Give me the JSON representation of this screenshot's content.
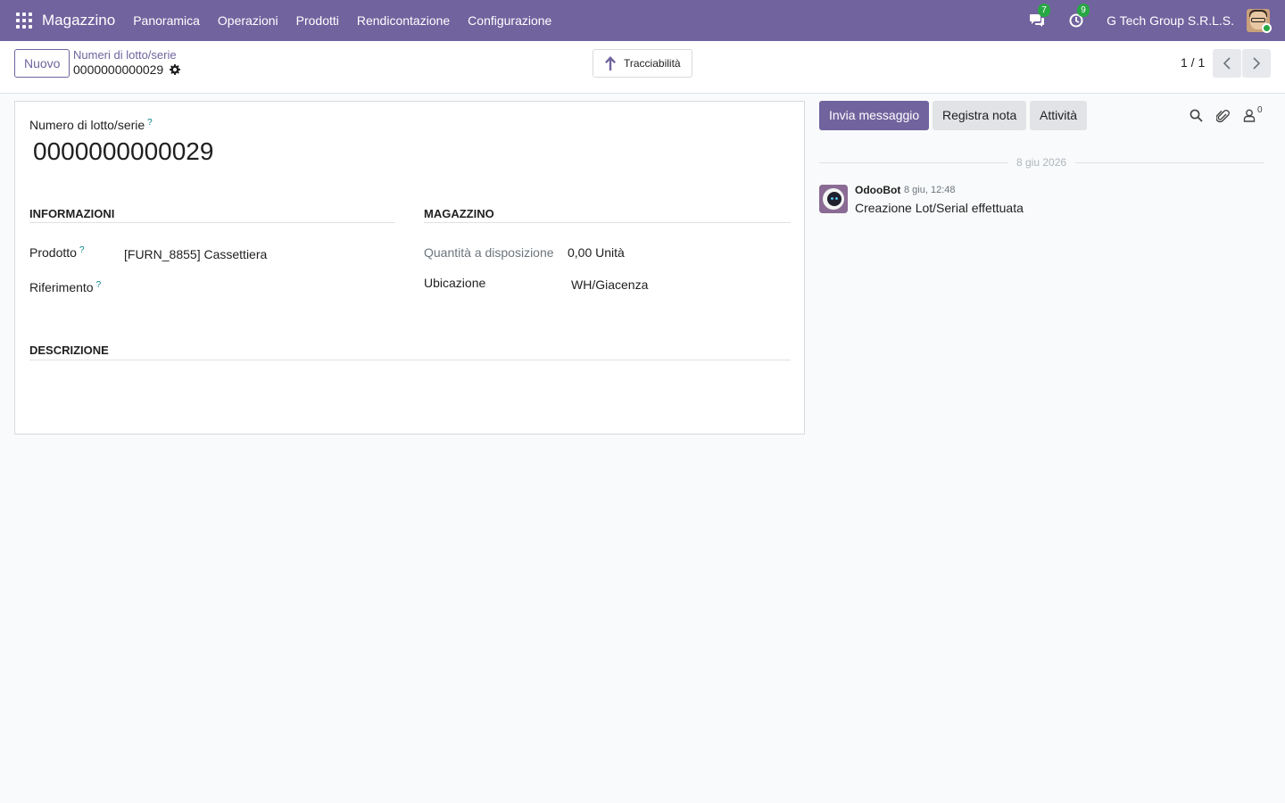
{
  "navbar": {
    "app_name": "Magazzino",
    "menu": [
      "Panoramica",
      "Operazioni",
      "Prodotti",
      "Rendicontazione",
      "Configurazione"
    ],
    "messages_count": "7",
    "activities_count": "9",
    "company": "G Tech Group S.R.L.S."
  },
  "control_panel": {
    "new_button": "Nuovo",
    "breadcrumb_parent": "Numeri di lotto/serie",
    "breadcrumb_current": "0000000000029",
    "traceability_button": "Tracciabilità",
    "pager": "1 / 1"
  },
  "form": {
    "name_label": "Numero di lotto/serie",
    "name_help": "?",
    "name_value": "0000000000029",
    "section_info": "INFORMAZIONI",
    "section_warehouse": "MAGAZZINO",
    "section_description": "DESCRIZIONE",
    "product_label": "Prodotto",
    "product_help": "?",
    "product_value": "[FURN_8855] Cassettiera",
    "reference_label": "Riferimento",
    "reference_help": "?",
    "qty_label": "Quantità a disposizione",
    "qty_value": "0,00 Unità",
    "location_label": "Ubicazione",
    "location_value": "WH/Giacenza"
  },
  "chatter": {
    "send_message": "Invia messaggio",
    "log_note": "Registra nota",
    "activity": "Attività",
    "followers_count": "0",
    "date_separator": "8 giu 2026",
    "message": {
      "author": "OdooBot",
      "date": "8 giu, 12:48",
      "body": "Creazione Lot/Serial effettuata"
    }
  },
  "colors": {
    "brand": "#71639e",
    "badge": "#28a745",
    "help": "#017e84"
  }
}
